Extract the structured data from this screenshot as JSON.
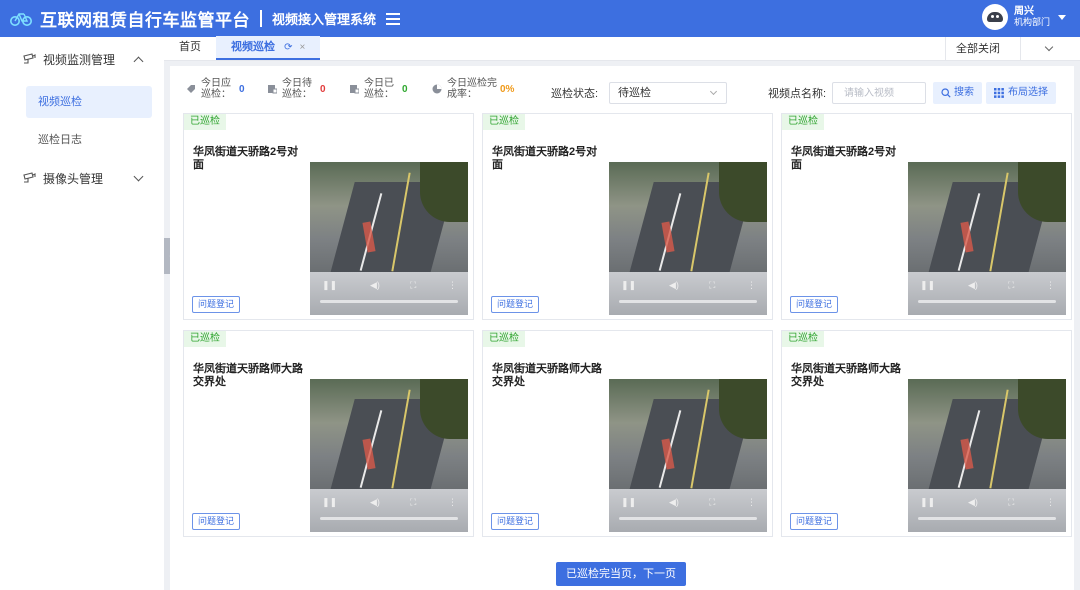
{
  "header": {
    "app_title": "互联网租赁自行车监管平台",
    "sub_title": "视频接入管理系统",
    "user_name": "周兴",
    "user_dept": "机构部门"
  },
  "sidebar": {
    "groups": [
      {
        "label": "视频监测管理",
        "expanded": true,
        "items": [
          "视频巡检",
          "巡检日志"
        ]
      },
      {
        "label": "摄像头管理",
        "expanded": false
      }
    ],
    "active_item": "视频巡检"
  },
  "tabs": {
    "items": [
      "首页",
      "视频巡检"
    ],
    "active": "视频巡检",
    "close_all": "全部关闭"
  },
  "stats": [
    {
      "label": "今日应巡检：",
      "value": "0",
      "color": "#3d6fe0"
    },
    {
      "label": "今日待巡检：",
      "value": "0",
      "color": "#e23c3c"
    },
    {
      "label": "今日已巡检：",
      "value": "0",
      "color": "#2fa82f"
    },
    {
      "label": "今日巡检完成率：",
      "value": "0%",
      "color": "#f09a1a"
    }
  ],
  "filters": {
    "status_label": "巡检状态:",
    "status_value": "待巡检",
    "name_label": "视频点名称:",
    "name_placeholder": "请输入视频",
    "search_button": "搜索",
    "layout_button": "布局选择"
  },
  "cards": [
    {
      "badge": "已巡检",
      "title": "华凤街道天骄路2号对面",
      "action": "问题登记"
    },
    {
      "badge": "已巡检",
      "title": "华凤街道天骄路2号对面",
      "action": "问题登记"
    },
    {
      "badge": "已巡检",
      "title": "华凤街道天骄路2号对面",
      "action": "问题登记"
    },
    {
      "badge": "已巡检",
      "title": "华凤街道天骄路师大路交界处",
      "action": "问题登记"
    },
    {
      "badge": "已巡检",
      "title": "华凤街道天骄路师大路交界处",
      "action": "问题登记"
    },
    {
      "badge": "已巡检",
      "title": "华凤街道天骄路师大路交界处",
      "action": "问题登记"
    }
  ],
  "next_button": "已巡检完当页，下一页",
  "colors": {
    "primary": "#3d6fe0",
    "badge_green": "#30a430"
  }
}
